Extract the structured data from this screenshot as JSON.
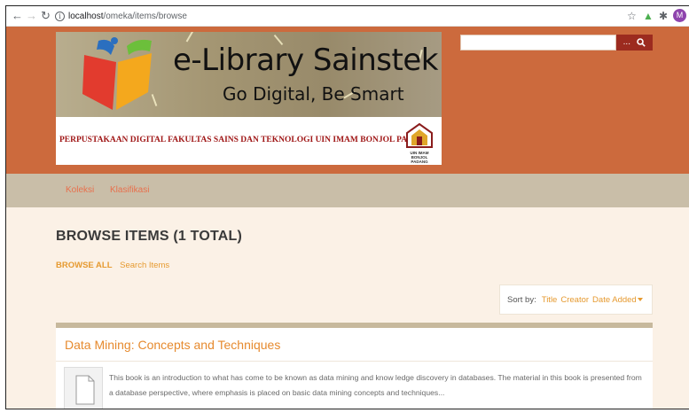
{
  "browser": {
    "url_host": "localhost",
    "url_path": "/omeka/items/browse",
    "avatar_letter": "M"
  },
  "header": {
    "banner_title": "e-Library Sainstek",
    "banner_subtitle": "Go Digital, Be Smart",
    "banner_tagline": "PERPUSTAKAAN DIGITAL FAKULTAS SAINS DAN TEKNOLOGI UIN IMAM BONJOL PADANG",
    "seal_text": "UIN IMAM BONJOL PADANG",
    "search": {
      "placeholder": "",
      "options_label": "...",
      "button_icon": "search-icon"
    }
  },
  "nav": {
    "items": [
      {
        "label": "Koleksi"
      },
      {
        "label": "Klasifikasi"
      }
    ]
  },
  "page": {
    "title": "BROWSE ITEMS (1 TOTAL)",
    "subnav": {
      "browse_all": "BROWSE ALL",
      "search_items": "Search Items"
    },
    "sort": {
      "label": "Sort by:",
      "options": [
        "Title",
        "Creator",
        "Date Added"
      ],
      "active": "Date Added"
    }
  },
  "items": [
    {
      "title": "Data Mining: Concepts and Techniques",
      "description": "This book is an introduction to what has come to be known as data mining and know ledge discovery in databases. The material in this book is presented from a database perspective, where emphasis is placed on basic data mining concepts and techniques..."
    }
  ],
  "colors": {
    "header_bg": "#cc6a3d",
    "nav_bg": "#c9bea8",
    "page_bg": "#fbf1e6",
    "accent": "#e69a30",
    "search_button": "#9c2b1f"
  }
}
